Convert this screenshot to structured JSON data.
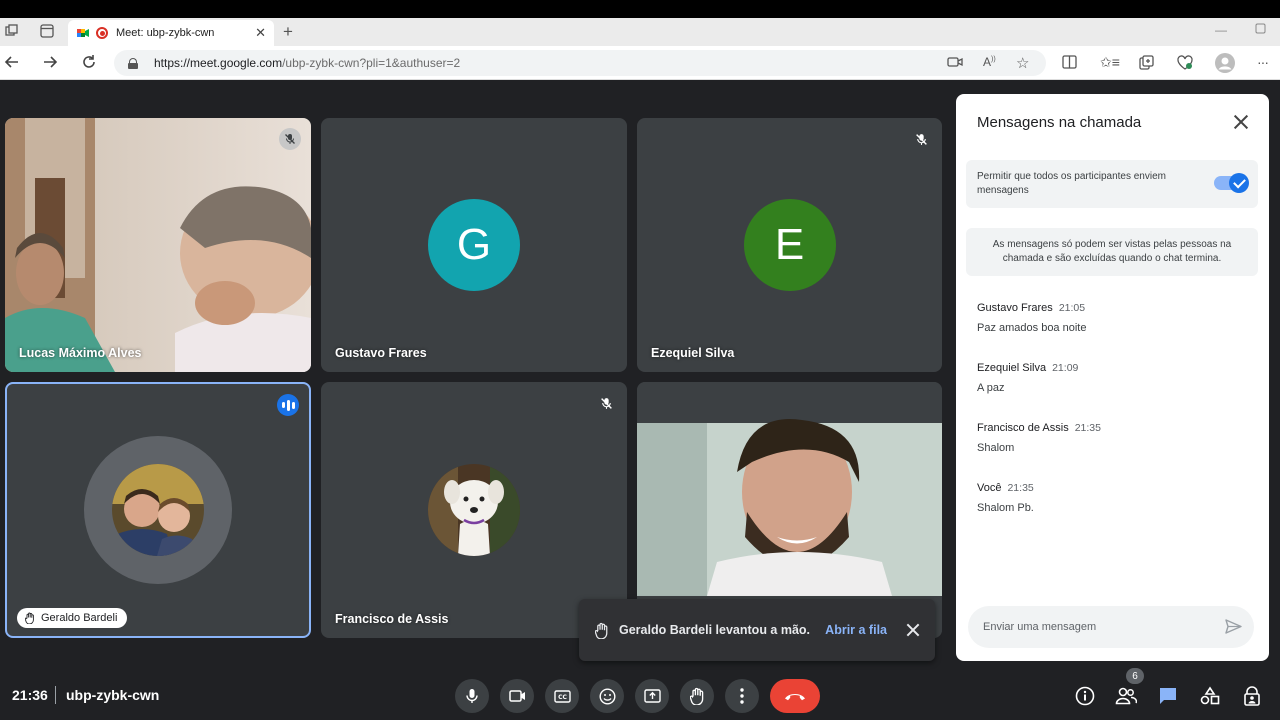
{
  "browser": {
    "tab_title": "Meet: ubp-zybk-cwn",
    "url_host": "https://meet.google.com",
    "url_path": "/ubp-zybk-cwn?pli=1&authuser=2"
  },
  "participants": [
    {
      "name": "Lucas Máximo Alves",
      "muted": true,
      "video": true
    },
    {
      "name": "Gustavo Frares",
      "avatar_letter": "G",
      "avatar_color": "#12a4af"
    },
    {
      "name": "Ezequiel Silva",
      "avatar_letter": "E",
      "avatar_color": "#33801e",
      "muted": true
    },
    {
      "name": "Geraldo Bardeli",
      "speaking": true,
      "hand_raised": true
    },
    {
      "name": "Francisco de Assis",
      "muted": true
    },
    {
      "name": "",
      "video": true
    }
  ],
  "toast": {
    "message": "Geraldo Bardeli levantou a mão.",
    "action": "Abrir a fila"
  },
  "chat": {
    "title": "Mensagens na chamada",
    "permission_text": "Permitir que todos os participantes enviem mensagens",
    "permission_enabled": true,
    "info_text": "As mensagens só podem ser vistas pelas pessoas na chamada e são excluídas quando o chat termina.",
    "messages": [
      {
        "sender": "Gustavo Frares",
        "time": "21:05",
        "text": "Paz amados boa noite"
      },
      {
        "sender": "Ezequiel Silva",
        "time": "21:09",
        "text": "A paz"
      },
      {
        "sender": "Francisco de Assis",
        "time": "21:35",
        "text": "Shalom"
      },
      {
        "sender": "Você",
        "time": "21:35",
        "text": "Shalom Pb."
      }
    ],
    "input_placeholder": "Enviar uma mensagem"
  },
  "bottombar": {
    "time": "21:36",
    "meeting_code": "ubp-zybk-cwn",
    "participant_count": "6"
  },
  "colors": {
    "meet_bg": "#202124",
    "tile_bg": "#3c4043",
    "accent": "#1a73e8",
    "hangup": "#ea4335"
  }
}
